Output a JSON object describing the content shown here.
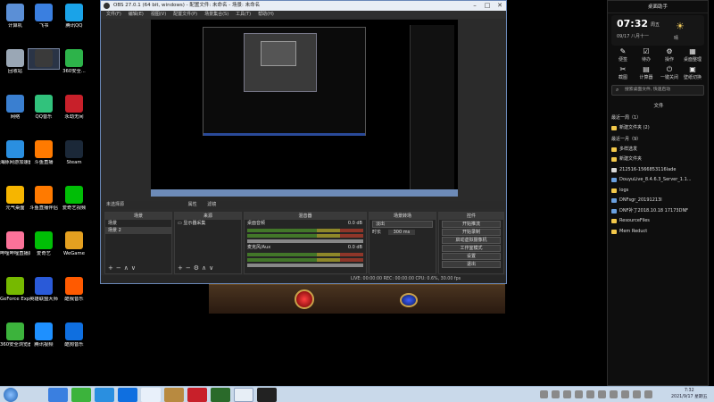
{
  "desktop_icons": [
    {
      "label": "计算机",
      "color": "#5b8fd6"
    },
    {
      "label": "飞书",
      "color": "#3a7fe0"
    },
    {
      "label": "腾讯QQ",
      "color": "#1aa3e8"
    },
    {
      "label": "回收站",
      "color": "#9aa7b5"
    },
    {
      "label": "",
      "color": "#3a3a3a"
    },
    {
      "label": "360安全...",
      "color": "#2db34a"
    },
    {
      "label": "网络",
      "color": "#3a7fd0"
    },
    {
      "label": "QQ音乐",
      "color": "#31c27c"
    },
    {
      "label": "永劫无间",
      "color": "#c8202a"
    },
    {
      "label": "海豚网游加速器5.0",
      "color": "#2a8fe0"
    },
    {
      "label": "斗鱼直播",
      "color": "#ff7a00"
    },
    {
      "label": "Steam",
      "color": "#1b2838"
    },
    {
      "label": "元气桌面",
      "color": "#f6b500"
    },
    {
      "label": "斗鱼直播伴侣",
      "color": "#ff7a00"
    },
    {
      "label": "爱奇艺视频",
      "color": "#00be06"
    },
    {
      "label": "哔哩哔哩直播姬",
      "color": "#fb7299"
    },
    {
      "label": "爱奇艺",
      "color": "#00be06"
    },
    {
      "label": "WeGame",
      "color": "#e4a020"
    },
    {
      "label": "GeForce Experience",
      "color": "#76b900"
    },
    {
      "label": "英雄联盟大师",
      "color": "#2a5ad8"
    },
    {
      "label": "酷我音乐",
      "color": "#ff5a00"
    },
    {
      "label": "360安全浏览器",
      "color": "#3cb33c"
    },
    {
      "label": "腾讯视频",
      "color": "#1e90ff"
    },
    {
      "label": "酷狗音乐",
      "color": "#0f6fe0"
    }
  ],
  "obs": {
    "title": "OBS 27.0.1 (64 bit, windows) - 配置文件: 未命名 - 场景: 未命名",
    "menu": [
      "文件(F)",
      "编辑(E)",
      "视图(V)",
      "配置文件(P)",
      "场景集合(S)",
      "工具(T)",
      "帮助(H)"
    ],
    "source_bar": "未选择源",
    "source_bar_buttons": [
      "属性",
      "滤镜"
    ],
    "docks": {
      "scenes": {
        "title": "场景",
        "items": [
          "场景",
          "场景 2"
        ]
      },
      "sources": {
        "title": "来源",
        "items": [
          "显示器采集"
        ]
      },
      "mixer": {
        "title": "混音器",
        "tracks": [
          {
            "name": "桌面音频",
            "level": "0.0 dB"
          },
          {
            "name": "麦克风/Aux",
            "level": "0.0 dB"
          }
        ]
      },
      "transitions": {
        "title": "场景转场",
        "type": "淡出",
        "duration_label": "时长",
        "duration": "300 ms"
      },
      "controls": {
        "title": "控件",
        "buttons": [
          "开始推流",
          "开始录制",
          "启动虚拟摄像机",
          "工作室模式",
          "设置",
          "退出"
        ]
      }
    },
    "status": "LIVE: 00:00:00   REC: 00:00:00   CPU: 0.6%, 30.00 fps"
  },
  "panel": {
    "title": "桌面助手",
    "clock": "07:32",
    "clock_label": "周五",
    "date": "09/17  八月十一",
    "weather": "晴",
    "tools": [
      "便签",
      "待办",
      "操作",
      "桌面整理",
      "截图",
      "计算器",
      "一键关闭",
      "壁纸切换"
    ],
    "search_placeholder": "搜索桌面文件, 快速启动",
    "files_title": "文件",
    "groups": [
      {
        "label": "最近一周（1）",
        "files": [
          {
            "name": "新建文件夹 (2)",
            "type": "folder"
          }
        ]
      },
      {
        "label": "最近一月（9）",
        "files": [
          {
            "name": "多样选发",
            "type": "folder"
          },
          {
            "name": "新建文件夹",
            "type": "folder"
          },
          {
            "name": "212516-1566853116lade",
            "type": "doc"
          },
          {
            "name": "DouyuLive_8.4.6.3_Server_1.1...",
            "type": "app"
          },
          {
            "name": "logs",
            "type": "folder"
          },
          {
            "name": "DNFsgr_20191213l",
            "type": "app"
          },
          {
            "name": "DNF补丁2018.10.18 17173DNF",
            "type": "app"
          },
          {
            "name": "ResourceFiles",
            "type": "folder"
          },
          {
            "name": "Mem Reduct",
            "type": "folder"
          }
        ]
      }
    ]
  },
  "taskbar": {
    "time": "7:32",
    "date": "2021/9/17 星期五"
  }
}
